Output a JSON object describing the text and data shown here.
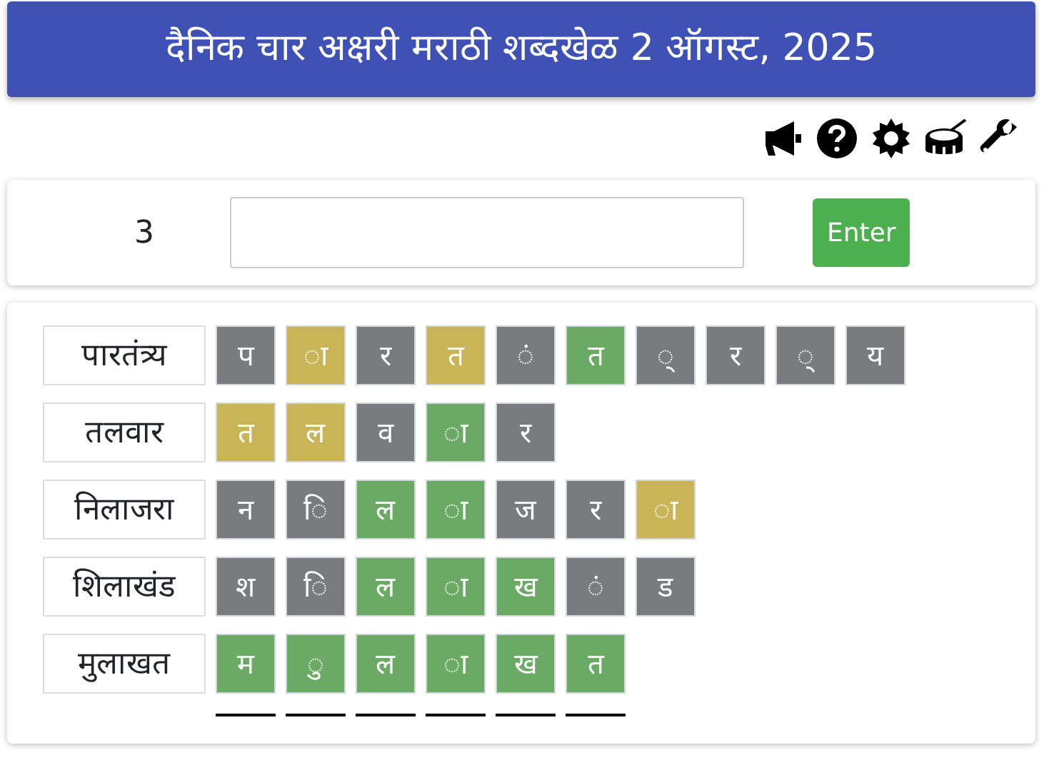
{
  "header": {
    "title": "दैनिक चार अक्षरी मराठी शब्दखेळ 2 ऑगस्ट, 2025"
  },
  "toolbar": [
    {
      "kind": "megaphone"
    },
    {
      "kind": "help"
    },
    {
      "kind": "settings"
    },
    {
      "kind": "drum"
    },
    {
      "kind": "wrench"
    }
  ],
  "entry": {
    "count": "3",
    "button": "Enter"
  },
  "guesses": [
    {
      "word": "पारतंत्र्य",
      "tiles": [
        {
          "letter": "प",
          "color": "#787c7e"
        },
        {
          "letter": "ा",
          "color": "#c9b458"
        },
        {
          "letter": "र",
          "color": "#787c7e"
        },
        {
          "letter": "त",
          "color": "#c9b458"
        },
        {
          "letter": "ं",
          "color": "#787c7e"
        },
        {
          "letter": "त",
          "color": "#6aaa64"
        },
        {
          "letter": "्",
          "color": "#787c7e"
        },
        {
          "letter": "र",
          "color": "#787c7e"
        },
        {
          "letter": "्",
          "color": "#787c7e"
        },
        {
          "letter": "य",
          "color": "#787c7e"
        }
      ]
    },
    {
      "word": "तलवार",
      "tiles": [
        {
          "letter": "त",
          "color": "#c9b458"
        },
        {
          "letter": "ल",
          "color": "#c9b458"
        },
        {
          "letter": "व",
          "color": "#787c7e"
        },
        {
          "letter": "ा",
          "color": "#6aaa64"
        },
        {
          "letter": "र",
          "color": "#787c7e"
        }
      ]
    },
    {
      "word": "निलाजरा",
      "tiles": [
        {
          "letter": "न",
          "color": "#787c7e"
        },
        {
          "letter": "ि",
          "color": "#787c7e"
        },
        {
          "letter": "ल",
          "color": "#6aaa64"
        },
        {
          "letter": "ा",
          "color": "#6aaa64"
        },
        {
          "letter": "ज",
          "color": "#787c7e"
        },
        {
          "letter": "र",
          "color": "#787c7e"
        },
        {
          "letter": "ा",
          "color": "#c9b458"
        }
      ]
    },
    {
      "word": "शिलाखंड",
      "tiles": [
        {
          "letter": "श",
          "color": "#787c7e"
        },
        {
          "letter": "ि",
          "color": "#787c7e"
        },
        {
          "letter": "ल",
          "color": "#6aaa64"
        },
        {
          "letter": "ा",
          "color": "#6aaa64"
        },
        {
          "letter": "ख",
          "color": "#6aaa64"
        },
        {
          "letter": "ं",
          "color": "#787c7e"
        },
        {
          "letter": "ड",
          "color": "#787c7e"
        }
      ]
    },
    {
      "word": "मुलाखत",
      "tiles": [
        {
          "letter": "म",
          "color": "#6aaa64"
        },
        {
          "letter": "ु",
          "color": "#6aaa64"
        },
        {
          "letter": "ल",
          "color": "#6aaa64"
        },
        {
          "letter": "ा",
          "color": "#6aaa64"
        },
        {
          "letter": "ख",
          "color": "#6aaa64"
        },
        {
          "letter": "त",
          "color": "#6aaa64"
        }
      ]
    }
  ],
  "answer_slots": [
    {
      "filled": false
    },
    {
      "filled": false
    },
    {
      "filled": false
    },
    {
      "filled": false
    },
    {
      "filled": false
    },
    {
      "filled": false
    }
  ]
}
